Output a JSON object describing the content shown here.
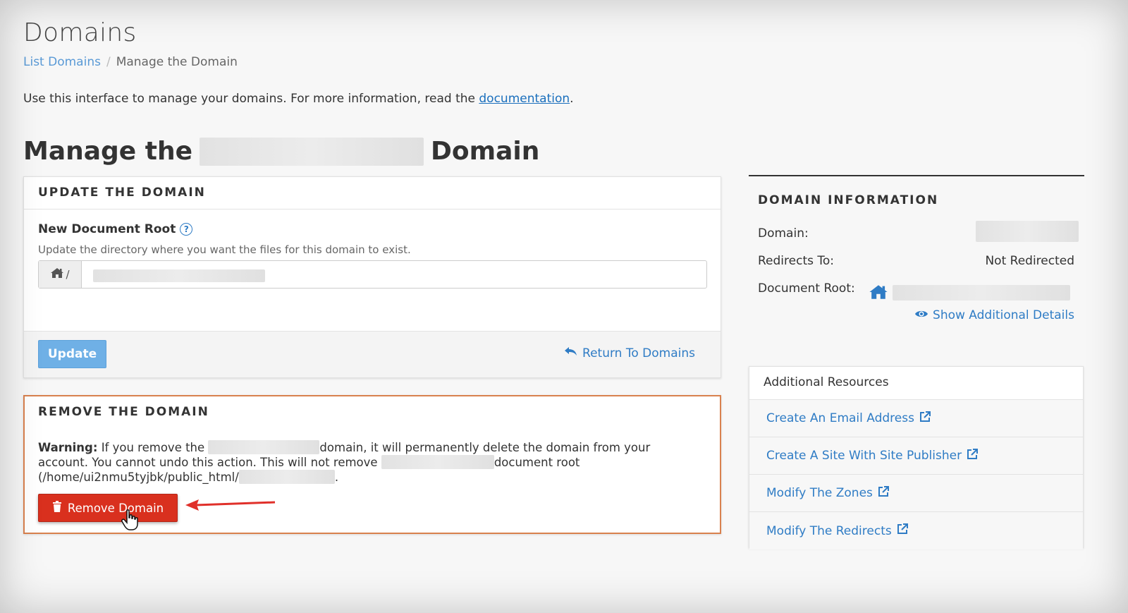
{
  "page": {
    "title": "Domains",
    "breadcrumb": {
      "link": "List Domains",
      "separator": "/",
      "current": "Manage the Domain"
    },
    "intro_text": "Use this interface to manage your domains. For more information, read the ",
    "intro_link": "documentation",
    "intro_end": ".",
    "manage_prefix": "Manage the",
    "manage_suffix": "Domain"
  },
  "update_panel": {
    "heading": "UPDATE THE DOMAIN",
    "field_label": "New Document Root",
    "help_glyph": "?",
    "field_help": "Update the directory where you want the files for this domain to exist.",
    "addon_text": "/",
    "update_button": "Update",
    "return_link": "Return To Domains"
  },
  "remove_panel": {
    "heading": "REMOVE THE DOMAIN",
    "warning_label": "Warning:",
    "warning_part1": "If you remove the",
    "warning_part2": "domain, it will permanently delete the domain from your account. You cannot undo this action. This will not remove",
    "warning_part3": "document root (/home/ui2nmu5tyjbk/public_html/",
    "warning_part4": ".",
    "remove_button": "Remove Domain"
  },
  "domain_info": {
    "heading": "DOMAIN INFORMATION",
    "domain_label": "Domain:",
    "redirects_label": "Redirects To:",
    "redirects_value": "Not Redirected",
    "docroot_label": "Document Root:",
    "show_details": "Show Additional Details"
  },
  "resources": {
    "heading": "Additional Resources",
    "items": [
      {
        "label": "Create An Email Address"
      },
      {
        "label": "Create A Site With Site Publisher"
      },
      {
        "label": "Modify The Zones"
      },
      {
        "label": "Modify The Redirects"
      }
    ]
  },
  "colors": {
    "link": "#2f7cc5",
    "update_button": "#6fb0e6",
    "remove_button": "#d9301e",
    "remove_border": "#d9814e",
    "annotation_arrow": "#e0302a"
  },
  "icons": [
    "help-icon",
    "home-icon",
    "return-arrow-icon",
    "trash-icon",
    "eye-icon",
    "external-link-icon",
    "hand-cursor-icon"
  ]
}
